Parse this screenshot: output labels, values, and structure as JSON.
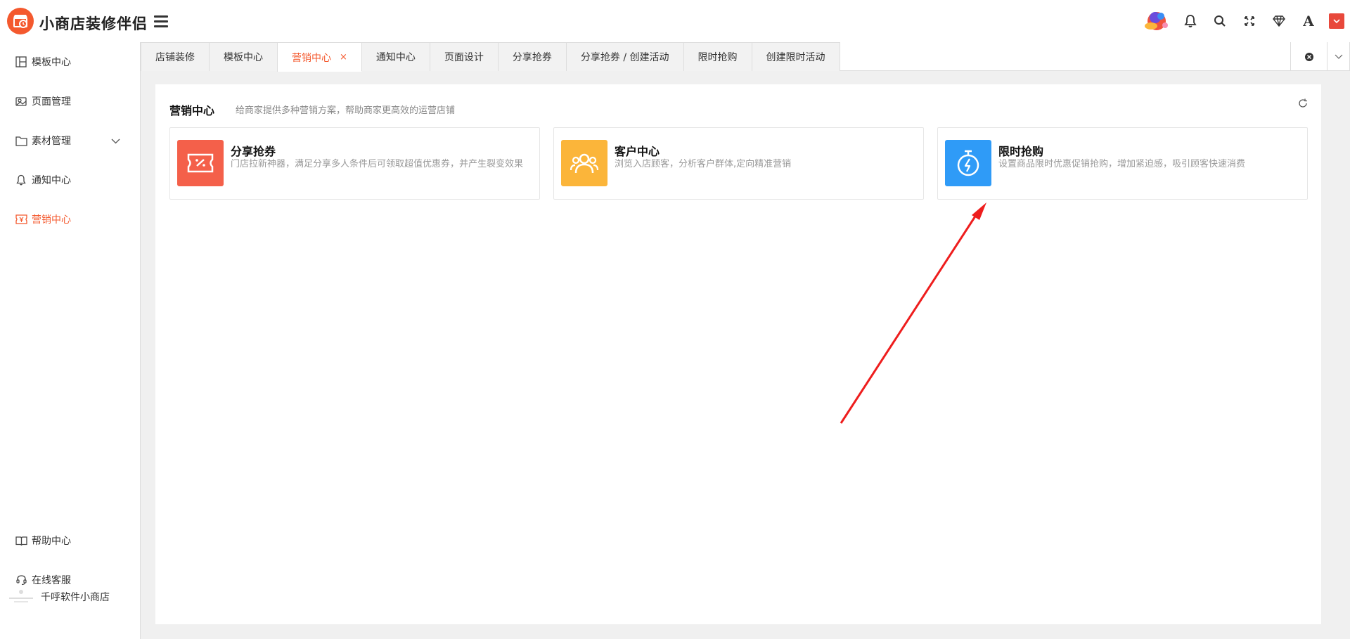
{
  "app": {
    "title": "小商店装修伴侣"
  },
  "header": {
    "icons": [
      "bell-icon",
      "search-icon",
      "fullscreen-icon",
      "diamond-icon",
      "font-icon"
    ],
    "font_icon_label": "A"
  },
  "sidebar": {
    "items": [
      {
        "label": "模板中心",
        "icon": "template-icon"
      },
      {
        "label": "页面管理",
        "icon": "page-icon"
      },
      {
        "label": "素材管理",
        "icon": "folder-icon"
      },
      {
        "label": "通知中心",
        "icon": "bell-icon"
      },
      {
        "label": "营销中心",
        "icon": "marketing-icon"
      }
    ],
    "bottom": [
      {
        "label": "帮助中心",
        "icon": "book-icon"
      },
      {
        "label": "在线客服",
        "icon": "headset-icon"
      }
    ],
    "user": {
      "name": "千呼软件小商店"
    }
  },
  "tabs": [
    {
      "label": "店铺装修"
    },
    {
      "label": "模板中心"
    },
    {
      "label": "营销中心",
      "close": "×"
    },
    {
      "label": "通知中心"
    },
    {
      "label": "页面设计"
    },
    {
      "label": "分享抢券"
    },
    {
      "label": "分享抢券 / 创建活动"
    },
    {
      "label": "限时抢购"
    },
    {
      "label": "创建限时活动"
    }
  ],
  "panel": {
    "title": "营销中心",
    "subtitle": "给商家提供多种营销方案，帮助商家更高效的运营店铺",
    "cards": [
      {
        "title": "分享抢券",
        "desc": "门店拉新神器，满足分享多人条件后可领取超值优惠券，并产生裂变效果",
        "color": "#f4604a",
        "icon": "coupon-icon"
      },
      {
        "title": "客户中心",
        "desc": "浏览入店顾客，分析客户群体,定向精准营销",
        "color": "#fbb53a",
        "icon": "users-icon"
      },
      {
        "title": "限时抢购",
        "desc": "设置商品限时优惠促销抢购，增加紧迫感，吸引顾客快速消费",
        "color": "#2f9bf7",
        "icon": "timer-icon"
      }
    ]
  },
  "colors": {
    "accent": "#f4592e",
    "annotation": "#ee1d1d"
  }
}
